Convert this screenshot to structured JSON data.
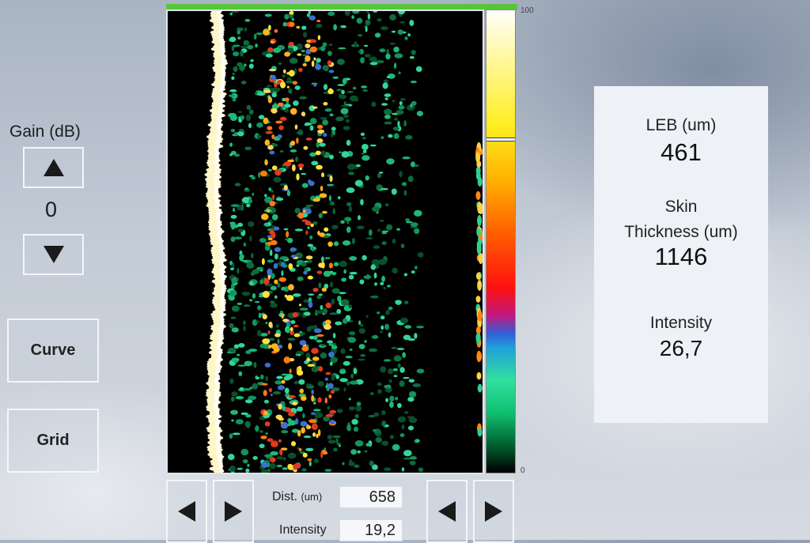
{
  "gain": {
    "label": "Gain (dB)",
    "value": "0",
    "up_icon": "triangle-up-icon",
    "down_icon": "triangle-down-icon"
  },
  "buttons": {
    "curve": "Curve",
    "grid": "Grid"
  },
  "scan": {
    "progress": 1.0,
    "progress_color": "#57c53a"
  },
  "colorbar": {
    "max_label": "100",
    "min_label": "0",
    "marker_level": 0.275
  },
  "results": {
    "leb_label": "LEB (um)",
    "leb_value": "461",
    "skin_label_line1": "Skin",
    "skin_label_line2": "Thickness (um)",
    "skin_value": "1146",
    "intensity_label": "Intensity",
    "intensity_value": "26,7"
  },
  "measure": {
    "dist_label": "Dist.",
    "dist_unit": "(um)",
    "dist_value": "658",
    "intensity_label": "Intensity",
    "intensity_value": "19,2"
  },
  "nav_icons": {
    "left": "triangle-left-icon",
    "right": "triangle-right-icon"
  }
}
